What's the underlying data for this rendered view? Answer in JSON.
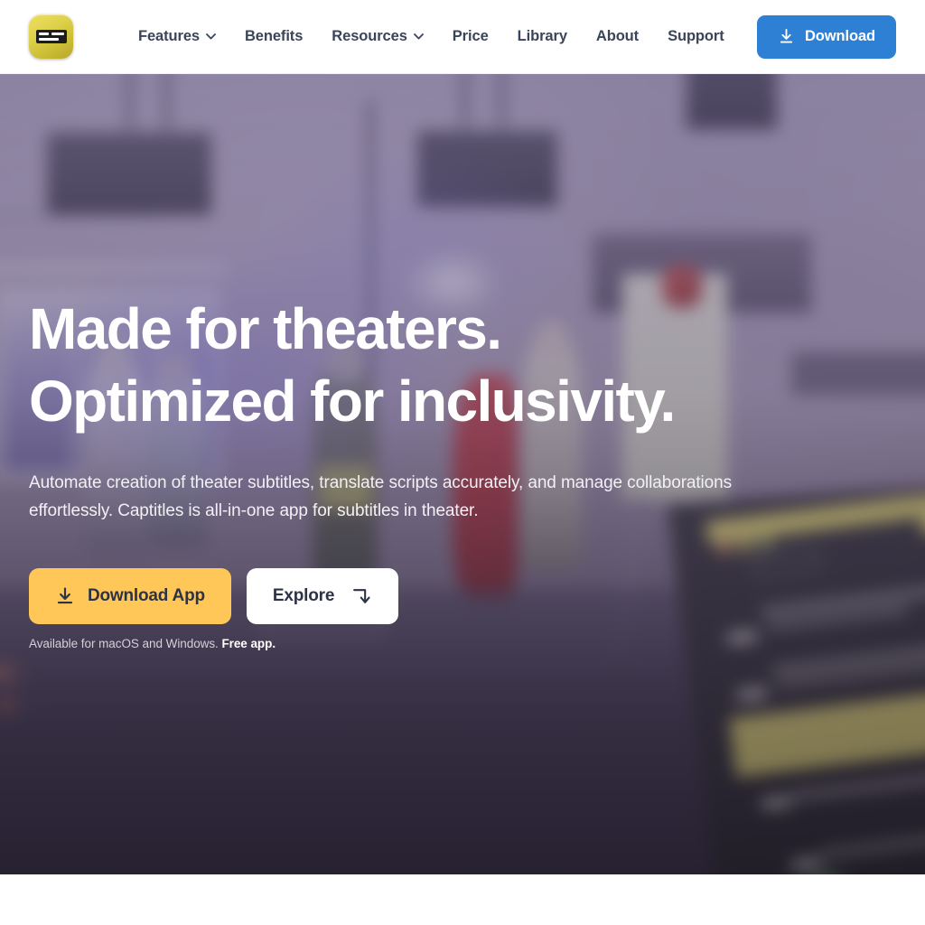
{
  "header": {
    "logo_name": "captitles-logo",
    "nav": [
      {
        "label": "Features",
        "has_chevron": true,
        "name": "nav-item-features"
      },
      {
        "label": "Benefits",
        "has_chevron": false,
        "name": "nav-item-benefits"
      },
      {
        "label": "Resources",
        "has_chevron": true,
        "name": "nav-item-resources"
      },
      {
        "label": "Price",
        "has_chevron": false,
        "name": "nav-item-price"
      },
      {
        "label": "Library",
        "has_chevron": false,
        "name": "nav-item-library"
      },
      {
        "label": "About",
        "has_chevron": false,
        "name": "nav-item-about"
      },
      {
        "label": "Support",
        "has_chevron": false,
        "name": "nav-item-support"
      }
    ],
    "download_button": {
      "label": "Download",
      "icon": "download-icon",
      "color": "#2e80d4"
    }
  },
  "hero": {
    "title_line1": "Made for theaters.",
    "title_line2": "Optimized for inclusivity.",
    "subtitle": "Automate creation of theater subtitles, translate scripts accurately, and manage collaborations effortlessly. Captitles is all-in-one app for subtitles in theater.",
    "primary_button": {
      "label": "Download App",
      "icon": "download-icon",
      "color": "#ffc757"
    },
    "secondary_button": {
      "label": "Explore",
      "icon": "arrow-turn-down-icon",
      "color": "#ffffff"
    },
    "availability_text": "Available for macOS and Windows.",
    "availability_emphasis": "Free app.",
    "background": "blurred photo of a theater rehearsal stage with performers, hanging monitors and a laptop showing the subtitle app",
    "overlay_color": "#6c608c"
  },
  "colors": {
    "nav_text": "#3b4458",
    "accent_blue": "#2e80d4",
    "accent_amber": "#ffc757",
    "dark_text": "#2c3347",
    "page_background": "#ffffff"
  }
}
